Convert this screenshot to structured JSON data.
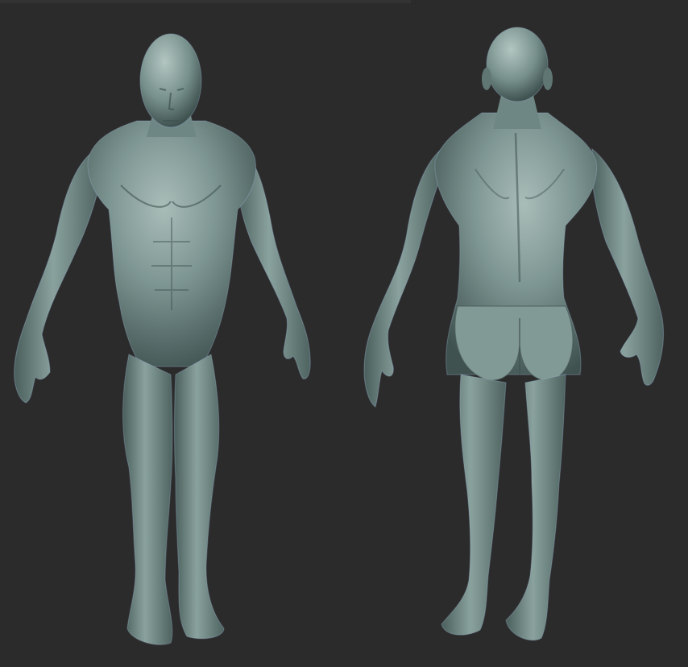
{
  "colors": {
    "background": "#2b2b2b",
    "skin_base": "#6f8784",
    "skin_light": "#a9bdb8",
    "skin_shadow": "#3f5250",
    "rim_light": "#9fb8d6"
  },
  "figures": [
    {
      "id": "front",
      "view": "front"
    },
    {
      "id": "back",
      "view": "back"
    }
  ]
}
